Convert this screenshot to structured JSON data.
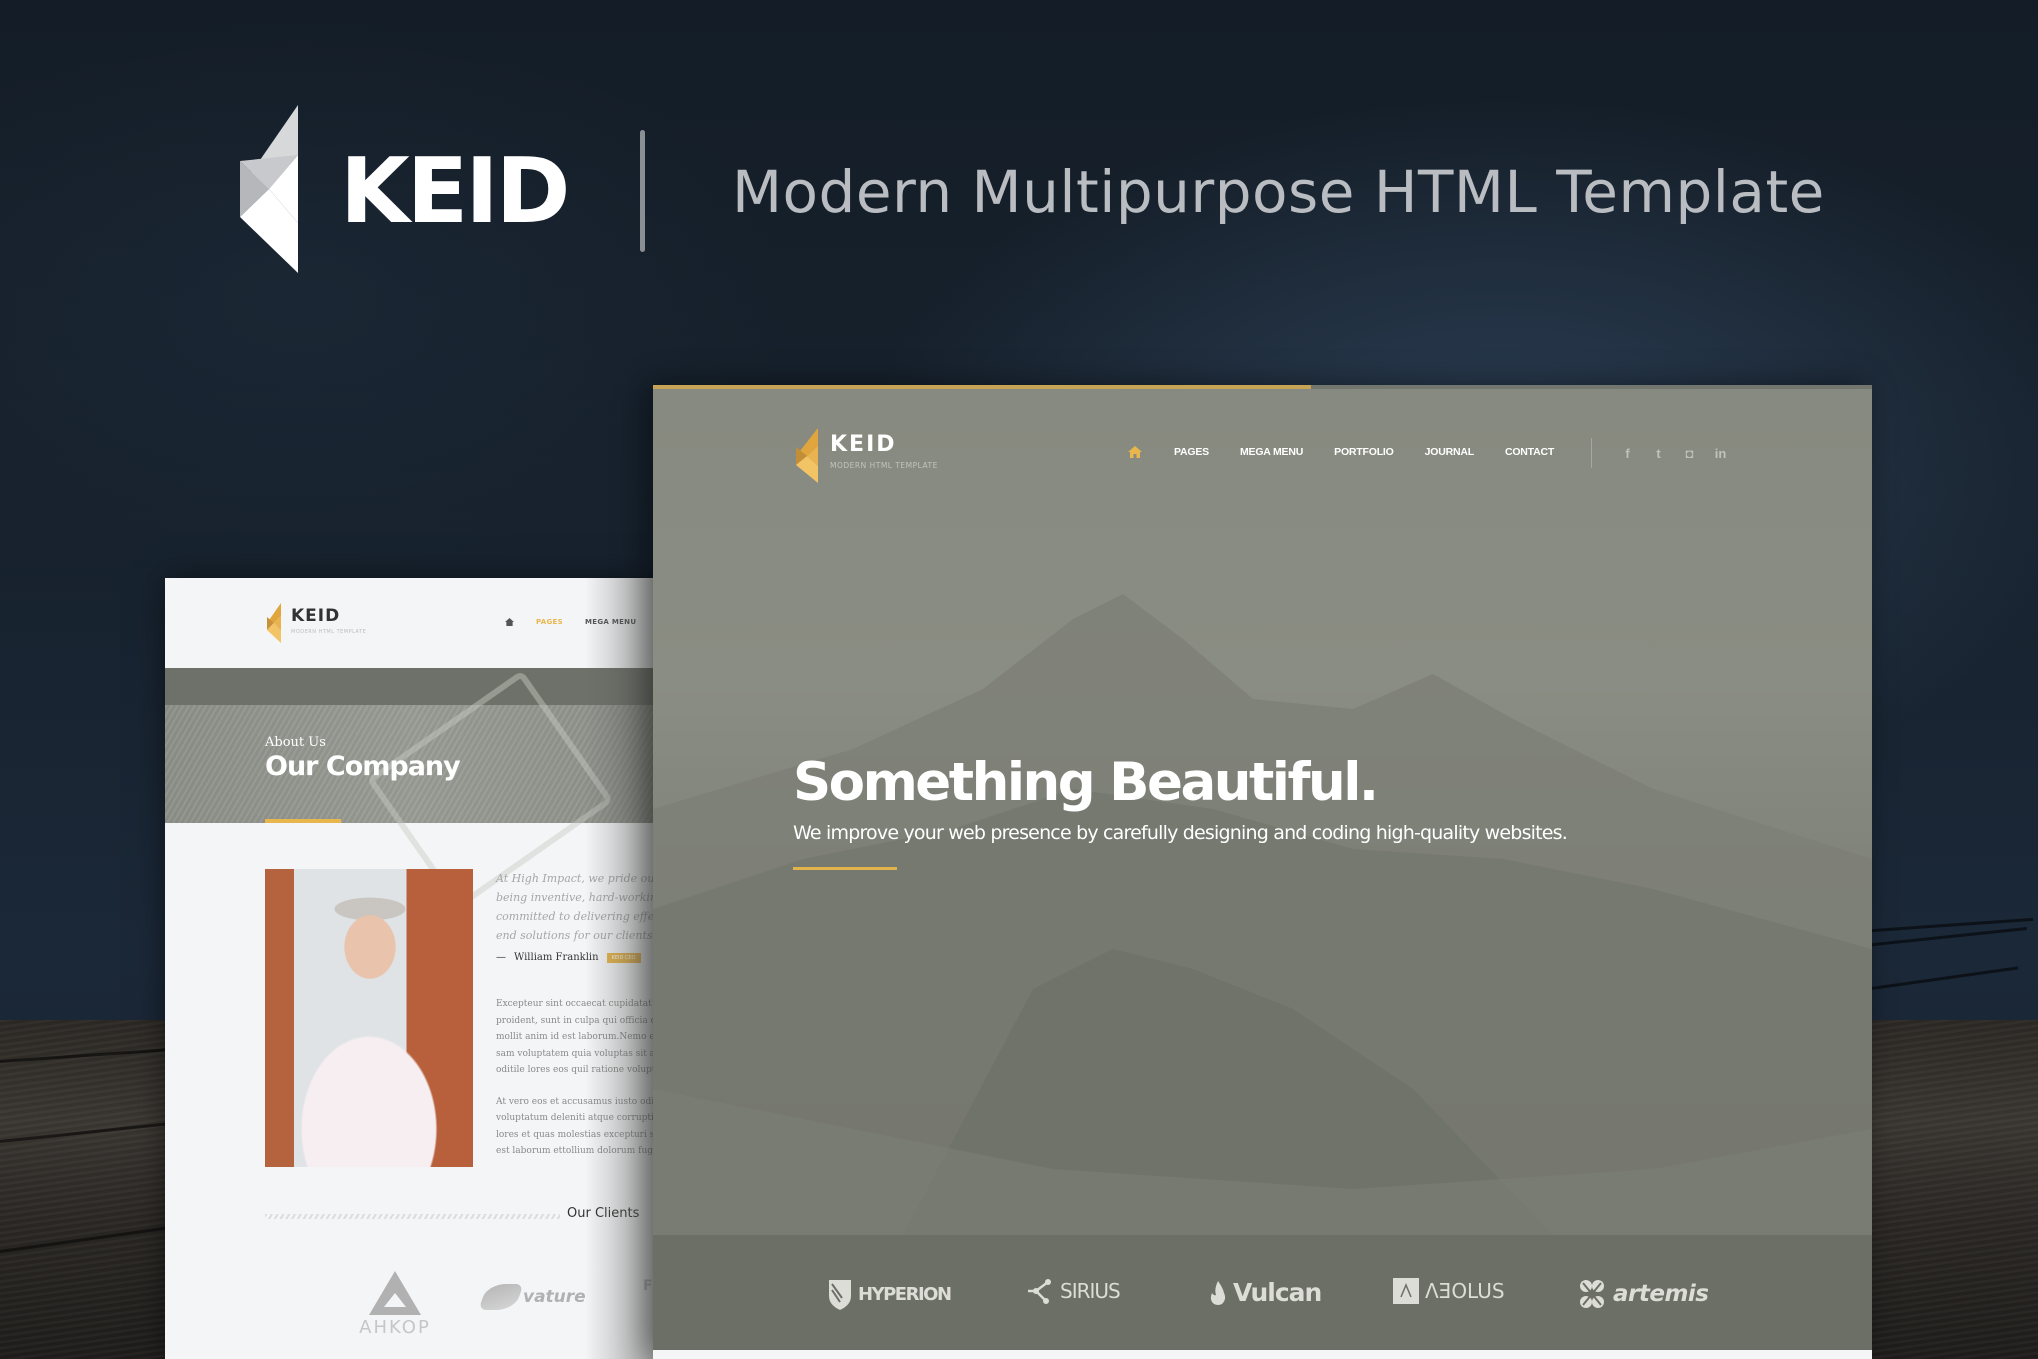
{
  "brand": {
    "name": "KEID",
    "tagline": "Modern Multipurpose HTML Template",
    "logo_icon": "keid-k-logo-icon"
  },
  "colors": {
    "accent": "#e8b64d",
    "progress_accent": "#c7a356",
    "background_dark": "#17222e",
    "hero_overlay": "#81847b",
    "clients_band": "#6c6f66"
  },
  "home_mockup": {
    "scroll_progress": 0.54,
    "logo": {
      "name": "KEID",
      "subtitle": "MODERN HTML TEMPLATE"
    },
    "nav": {
      "home_icon": "home-icon",
      "items": [
        {
          "label": "PAGES"
        },
        {
          "label": "MEGA MENU"
        },
        {
          "label": "PORTFOLIO"
        },
        {
          "label": "JOURNAL"
        },
        {
          "label": "CONTACT"
        }
      ]
    },
    "social": [
      {
        "icon": "facebook-icon",
        "glyph": "f"
      },
      {
        "icon": "twitter-icon",
        "glyph": "t"
      },
      {
        "icon": "instagram-icon",
        "glyph": "◘"
      },
      {
        "icon": "linkedin-icon",
        "glyph": "in"
      }
    ],
    "hero": {
      "headline": "Something Beautiful.",
      "subheadline": "We improve your web presence by carefully designing and coding high-quality websites."
    },
    "clients": [
      {
        "name": "HYPERION",
        "icon": "shield-icon"
      },
      {
        "name": "SIRIUS",
        "icon": "molecule-icon"
      },
      {
        "name": "Vulcan",
        "icon": "flame-icon"
      },
      {
        "name": "ΛƎOLUS",
        "icon": "aeolus-square-icon"
      },
      {
        "name": "artemis",
        "icon": "clover-icon"
      }
    ]
  },
  "about_mockup": {
    "logo": {
      "name": "KEID",
      "subtitle": "MODERN HTML TEMPLATE"
    },
    "nav": {
      "home_icon": "home-icon",
      "items": [
        {
          "label": "PAGES",
          "active": true
        },
        {
          "label": "MEGA MENU",
          "active": false
        }
      ]
    },
    "page_header": {
      "kicker": "About Us",
      "title": "Our Company"
    },
    "quote": {
      "lines": [
        "At High Impact, we pride ou",
        "being inventive, hard-working",
        "committed to delivering effec",
        "end solutions for our clients."
      ],
      "author": "William Franklin",
      "author_badge": "KEID CEO"
    },
    "body": {
      "paragraph_1": [
        "Excepteur sint occaecat cupidatat n",
        "proident, sunt in culpa qui officia de",
        "mollit anim id est laborum.Nemo en",
        "sam voluptatem quia voluptas sit as",
        "oditile lores eos quil ratione volupta"
      ],
      "paragraph_2": [
        "At vero eos et accusamus iusto odio",
        "voluptatum deleniti atque corrupti",
        "lores et quas molestias excepturi si",
        "est laborum ettollium dolorum fuga"
      ]
    },
    "clients": {
      "title": "Our Clients",
      "items": [
        {
          "name": "AHKOP"
        },
        {
          "name": "vature"
        },
        {
          "name": "FL"
        }
      ]
    }
  }
}
